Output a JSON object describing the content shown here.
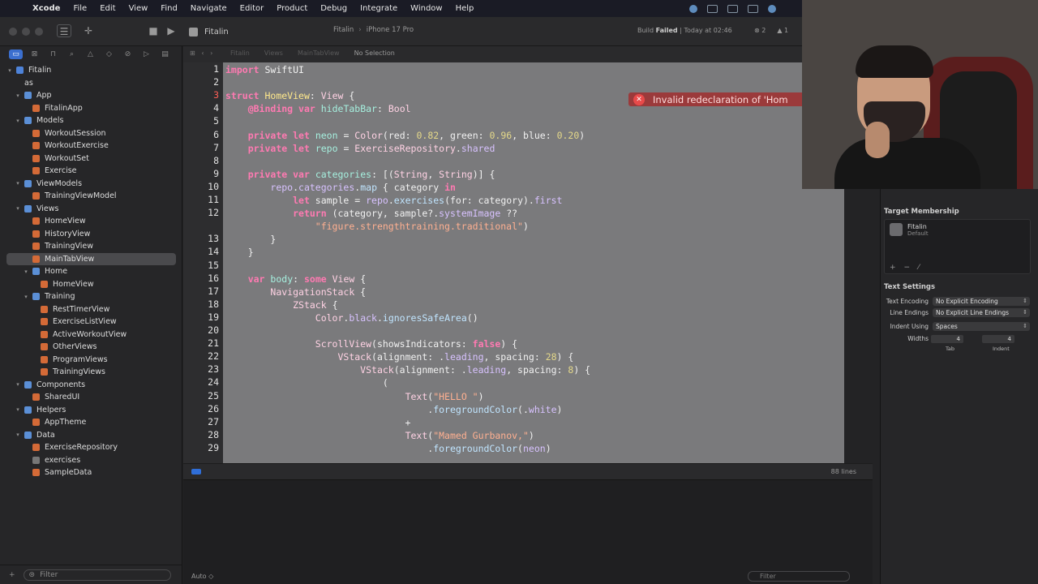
{
  "menubar": {
    "items": [
      "Xcode",
      "File",
      "Edit",
      "View",
      "Find",
      "Navigate",
      "Editor",
      "Product",
      "Debug",
      "Integrate",
      "Window",
      "Help"
    ]
  },
  "toolbar": {
    "file_tab": "Fitalin",
    "scheme": "Fitalin",
    "device": "iPhone 17 Pro",
    "build_prefix": "Build ",
    "build_result": "Failed",
    "build_time": " | Today at 02:46",
    "error_count": "2",
    "warning_count": "1"
  },
  "jumpbar": {
    "crumbs": [
      "Fitalin",
      "Views",
      "MainTabView"
    ],
    "selection": "No Selection"
  },
  "navigator": {
    "filter_placeholder": "Filter",
    "items": [
      {
        "label": "Fitalin",
        "kind": "proj",
        "indent": 0,
        "disc": "▾"
      },
      {
        "label": "as",
        "kind": "none",
        "indent": 1,
        "disc": ""
      },
      {
        "label": "App",
        "kind": "folder",
        "indent": 1,
        "disc": "▾"
      },
      {
        "label": "FitalinApp",
        "kind": "swift",
        "indent": 2,
        "disc": ""
      },
      {
        "label": "Models",
        "kind": "folder",
        "indent": 1,
        "disc": "▾"
      },
      {
        "label": "WorkoutSession",
        "kind": "swift",
        "indent": 2,
        "disc": ""
      },
      {
        "label": "WorkoutExercise",
        "kind": "swift",
        "indent": 2,
        "disc": ""
      },
      {
        "label": "WorkoutSet",
        "kind": "swift",
        "indent": 2,
        "disc": ""
      },
      {
        "label": "Exercise",
        "kind": "swift",
        "indent": 2,
        "disc": ""
      },
      {
        "label": "ViewModels",
        "kind": "folder",
        "indent": 1,
        "disc": "▾"
      },
      {
        "label": "TrainingViewModel",
        "kind": "swift",
        "indent": 2,
        "disc": ""
      },
      {
        "label": "Views",
        "kind": "folder",
        "indent": 1,
        "disc": "▾"
      },
      {
        "label": "HomeView",
        "kind": "swift",
        "indent": 2,
        "disc": ""
      },
      {
        "label": "HistoryView",
        "kind": "swift",
        "indent": 2,
        "disc": ""
      },
      {
        "label": "TrainingView",
        "kind": "swift",
        "indent": 2,
        "disc": ""
      },
      {
        "label": "MainTabView",
        "kind": "swift",
        "indent": 2,
        "disc": "",
        "selected": true
      },
      {
        "label": "Home",
        "kind": "folder",
        "indent": 2,
        "disc": "▾"
      },
      {
        "label": "HomeView",
        "kind": "swift",
        "indent": 3,
        "disc": ""
      },
      {
        "label": "Training",
        "kind": "folder",
        "indent": 2,
        "disc": "▾"
      },
      {
        "label": "RestTimerView",
        "kind": "swift",
        "indent": 3,
        "disc": ""
      },
      {
        "label": "ExerciseListView",
        "kind": "swift",
        "indent": 3,
        "disc": ""
      },
      {
        "label": "ActiveWorkoutView",
        "kind": "swift",
        "indent": 3,
        "disc": ""
      },
      {
        "label": "OtherViews",
        "kind": "swift",
        "indent": 3,
        "disc": ""
      },
      {
        "label": "ProgramViews",
        "kind": "swift",
        "indent": 3,
        "disc": ""
      },
      {
        "label": "TrainingViews",
        "kind": "swift",
        "indent": 3,
        "disc": ""
      },
      {
        "label": "Components",
        "kind": "folder",
        "indent": 1,
        "disc": "▾"
      },
      {
        "label": "SharedUI",
        "kind": "swift",
        "indent": 2,
        "disc": ""
      },
      {
        "label": "Helpers",
        "kind": "folder",
        "indent": 1,
        "disc": "▾"
      },
      {
        "label": "AppTheme",
        "kind": "swift",
        "indent": 2,
        "disc": ""
      },
      {
        "label": "Data",
        "kind": "folder",
        "indent": 1,
        "disc": "▾"
      },
      {
        "label": "ExerciseRepository",
        "kind": "swift",
        "indent": 2,
        "disc": ""
      },
      {
        "label": "exercises",
        "kind": "json",
        "indent": 2,
        "disc": ""
      },
      {
        "label": "SampleData",
        "kind": "swift",
        "indent": 2,
        "disc": ""
      }
    ]
  },
  "editor": {
    "error_message": "Invalid redeclaration of 'Hom",
    "line_count": "88 lines",
    "lines": [
      {
        "n": "1",
        "slot": 0,
        "code": [
          [
            "kw",
            "import"
          ],
          [
            "p",
            " SwiftUI"
          ]
        ]
      },
      {
        "n": "2",
        "slot": 1,
        "code": []
      },
      {
        "n": "3",
        "slot": 2,
        "err": true,
        "code": [
          [
            "kw",
            "struct"
          ],
          [
            "p",
            " "
          ],
          [
            "ty",
            "HomeView"
          ],
          [
            "p",
            ": "
          ],
          [
            "tp",
            "View"
          ],
          [
            "p",
            " {"
          ]
        ]
      },
      {
        "n": "4",
        "slot": 3,
        "code": [
          [
            "p",
            "    "
          ],
          [
            "kw",
            "@Binding"
          ],
          [
            "p",
            " "
          ],
          [
            "kw",
            "var"
          ],
          [
            "p",
            " "
          ],
          [
            "idt",
            "hideTabBar"
          ],
          [
            "p",
            ": "
          ],
          [
            "tp",
            "Bool"
          ]
        ]
      },
      {
        "n": "5",
        "slot": 4,
        "code": []
      },
      {
        "n": "6",
        "slot": 5,
        "code": [
          [
            "p",
            "    "
          ],
          [
            "kw",
            "private let"
          ],
          [
            "p",
            " "
          ],
          [
            "idt",
            "neon"
          ],
          [
            "p",
            " = "
          ],
          [
            "tp",
            "Color"
          ],
          [
            "p",
            "(red: "
          ],
          [
            "num",
            "0.82"
          ],
          [
            "p",
            ", green: "
          ],
          [
            "num",
            "0.96"
          ],
          [
            "p",
            ", blue: "
          ],
          [
            "num",
            "0.20"
          ],
          [
            "p",
            ")"
          ]
        ]
      },
      {
        "n": "7",
        "slot": 6,
        "code": [
          [
            "p",
            "    "
          ],
          [
            "kw",
            "private let"
          ],
          [
            "p",
            " "
          ],
          [
            "idt",
            "repo"
          ],
          [
            "p",
            " = "
          ],
          [
            "tp",
            "ExerciseRepository"
          ],
          [
            "p",
            "."
          ],
          [
            "pr",
            "shared"
          ]
        ]
      },
      {
        "n": "8",
        "slot": 7,
        "code": []
      },
      {
        "n": "9",
        "slot": 8,
        "code": [
          [
            "p",
            "    "
          ],
          [
            "kw",
            "private var"
          ],
          [
            "p",
            " "
          ],
          [
            "idt",
            "categories"
          ],
          [
            "p",
            ": [("
          ],
          [
            "tp",
            "String"
          ],
          [
            "p",
            ", "
          ],
          [
            "tp",
            "String"
          ],
          [
            "p",
            ")] {"
          ]
        ]
      },
      {
        "n": "10",
        "slot": 9,
        "code": [
          [
            "p",
            "        "
          ],
          [
            "pr",
            "repo"
          ],
          [
            "p",
            "."
          ],
          [
            "pr",
            "categories"
          ],
          [
            "p",
            "."
          ],
          [
            "fn",
            "map"
          ],
          [
            "p",
            " { category "
          ],
          [
            "kw",
            "in"
          ]
        ]
      },
      {
        "n": "11",
        "slot": 10,
        "code": [
          [
            "p",
            "            "
          ],
          [
            "kw",
            "let"
          ],
          [
            "p",
            " sample = "
          ],
          [
            "pr",
            "repo"
          ],
          [
            "p",
            "."
          ],
          [
            "fn",
            "exercises"
          ],
          [
            "p",
            "(for: category)."
          ],
          [
            "pr",
            "first"
          ]
        ]
      },
      {
        "n": "12",
        "slot": 11,
        "code": [
          [
            "p",
            "            "
          ],
          [
            "kw",
            "return"
          ],
          [
            "p",
            " (category, sample?."
          ],
          [
            "pr",
            "systemImage"
          ],
          [
            "p",
            " ??"
          ]
        ]
      },
      {
        "n": "",
        "slot": 12,
        "code": [
          [
            "p",
            "                "
          ],
          [
            "str",
            "\"figure.strengthtraining.traditional\""
          ],
          [
            "p",
            ")"
          ]
        ]
      },
      {
        "n": "13",
        "slot": 13,
        "code": [
          [
            "p",
            "        }"
          ]
        ]
      },
      {
        "n": "14",
        "slot": 14,
        "code": [
          [
            "p",
            "    }"
          ]
        ]
      },
      {
        "n": "15",
        "slot": 15,
        "code": []
      },
      {
        "n": "16",
        "slot": 16,
        "code": [
          [
            "p",
            "    "
          ],
          [
            "kw",
            "var"
          ],
          [
            "p",
            " "
          ],
          [
            "idt",
            "body"
          ],
          [
            "p",
            ": "
          ],
          [
            "kw",
            "some"
          ],
          [
            "p",
            " "
          ],
          [
            "tp",
            "View"
          ],
          [
            "p",
            " {"
          ]
        ]
      },
      {
        "n": "17",
        "slot": 17,
        "code": [
          [
            "p",
            "        "
          ],
          [
            "tp",
            "NavigationStack"
          ],
          [
            "p",
            " {"
          ]
        ]
      },
      {
        "n": "18",
        "slot": 18,
        "code": [
          [
            "p",
            "            "
          ],
          [
            "tp",
            "ZStack"
          ],
          [
            "p",
            " {"
          ]
        ]
      },
      {
        "n": "19",
        "slot": 19,
        "code": [
          [
            "p",
            "                "
          ],
          [
            "tp",
            "Color"
          ],
          [
            "p",
            "."
          ],
          [
            "pr",
            "black"
          ],
          [
            "p",
            "."
          ],
          [
            "fn",
            "ignoresSafeArea"
          ],
          [
            "p",
            "()"
          ]
        ]
      },
      {
        "n": "20",
        "slot": 20,
        "code": []
      },
      {
        "n": "21",
        "slot": 21,
        "code": [
          [
            "p",
            "                "
          ],
          [
            "tp",
            "ScrollView"
          ],
          [
            "p",
            "(showsIndicators: "
          ],
          [
            "kw",
            "false"
          ],
          [
            "p",
            ") {"
          ]
        ]
      },
      {
        "n": "22",
        "slot": 22,
        "code": [
          [
            "p",
            "                    "
          ],
          [
            "tp",
            "VStack"
          ],
          [
            "p",
            "(alignment: ."
          ],
          [
            "pr",
            "leading"
          ],
          [
            "p",
            ", spacing: "
          ],
          [
            "num",
            "28"
          ],
          [
            "p",
            ") {"
          ]
        ]
      },
      {
        "n": "23",
        "slot": 23,
        "code": [
          [
            "p",
            "                        "
          ],
          [
            "tp",
            "VStack"
          ],
          [
            "p",
            "(alignment: ."
          ],
          [
            "pr",
            "leading"
          ],
          [
            "p",
            ", spacing: "
          ],
          [
            "num",
            "8"
          ],
          [
            "p",
            ") {"
          ]
        ]
      },
      {
        "n": "24",
        "slot": 24,
        "code": [
          [
            "p",
            "                            ("
          ]
        ]
      },
      {
        "n": "25",
        "slot": 25,
        "code": [
          [
            "p",
            "                                "
          ],
          [
            "tp",
            "Text"
          ],
          [
            "p",
            "("
          ],
          [
            "str",
            "\"HELLO \""
          ],
          [
            "p",
            ")"
          ]
        ]
      },
      {
        "n": "26",
        "slot": 26,
        "code": [
          [
            "p",
            "                                    ."
          ],
          [
            "fn",
            "foregroundColor"
          ],
          [
            "p",
            "(."
          ],
          [
            "pr",
            "white"
          ],
          [
            "p",
            ")"
          ]
        ]
      },
      {
        "n": "27",
        "slot": 27,
        "code": [
          [
            "p",
            "                                +"
          ]
        ]
      },
      {
        "n": "28",
        "slot": 28,
        "code": [
          [
            "p",
            "                                "
          ],
          [
            "tp",
            "Text"
          ],
          [
            "p",
            "("
          ],
          [
            "str",
            "\"Mamed Gurbanov,\""
          ],
          [
            "p",
            ")"
          ]
        ]
      },
      {
        "n": "29",
        "slot": 29,
        "code": [
          [
            "p",
            "                                    ."
          ],
          [
            "fn",
            "foregroundColor"
          ],
          [
            "p",
            "("
          ],
          [
            "pr",
            "neon"
          ],
          [
            "p",
            ")"
          ]
        ]
      }
    ]
  },
  "debug": {
    "auto_label": "Auto ◇",
    "filter_placeholder": "Filter"
  },
  "inspector": {
    "target_membership_title": "Target Membership",
    "target_name": "Fitalin",
    "target_sub": "Default",
    "text_settings_title": "Text Settings",
    "text_encoding_label": "Text Encoding",
    "text_encoding_value": "No Explicit Encoding",
    "line_endings_label": "Line Endings",
    "line_endings_value": "No Explicit Line Endings",
    "indent_using_label": "Indent Using",
    "indent_using_value": "Spaces",
    "widths_label": "Widths",
    "tab_width": "4",
    "indent_width": "4",
    "tab_caption": "Tab",
    "indent_caption": "Indent"
  },
  "colors": {
    "accent": "#3b6fcf",
    "error": "#9b3a3b"
  }
}
